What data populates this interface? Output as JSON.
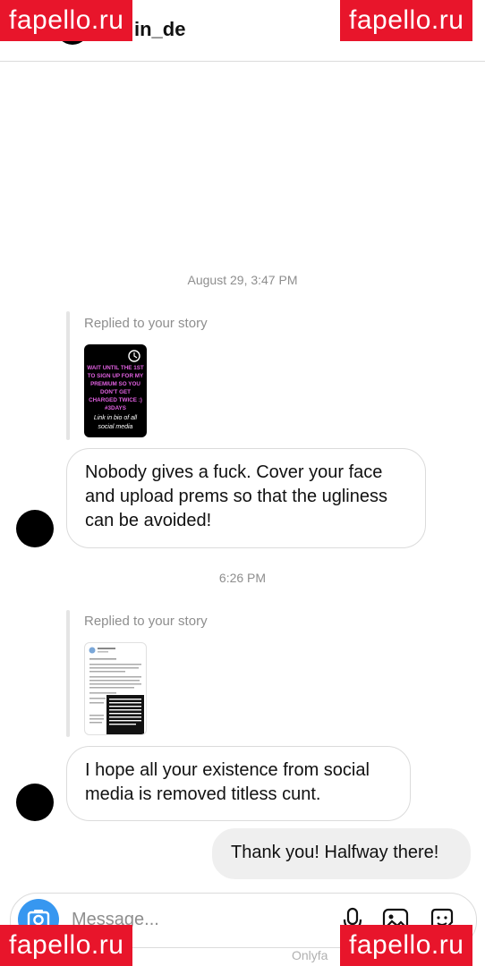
{
  "header": {
    "username": "in_de"
  },
  "watermark": "fapello.ru",
  "thread": {
    "timestamp_1": "August 29, 3:47 PM",
    "replied_label_1": "Replied to your story",
    "story_1_text": "WAIT UNTIL THE 1ST TO SIGN UP FOR MY PREMIUM SO YOU DON'T GET CHARGED TWICE :) #3DAYS",
    "story_1_caption": "Link in bio of all social media",
    "message_1": "Nobody gives a fuck. Cover your face and upload prems so that the ugliness can be avoided!",
    "timestamp_2": "6:26 PM",
    "replied_label_2": "Replied to your story",
    "message_2": "I hope all your existence from social media is removed titless cunt.",
    "reply": "Thank you! Halfway there!"
  },
  "composer": {
    "placeholder": "Message..."
  },
  "footer": {
    "text": "Onlyfa"
  },
  "colors": {
    "accent": "#3797f0",
    "watermark": "#e8152b",
    "story_text": "#e060e0"
  }
}
